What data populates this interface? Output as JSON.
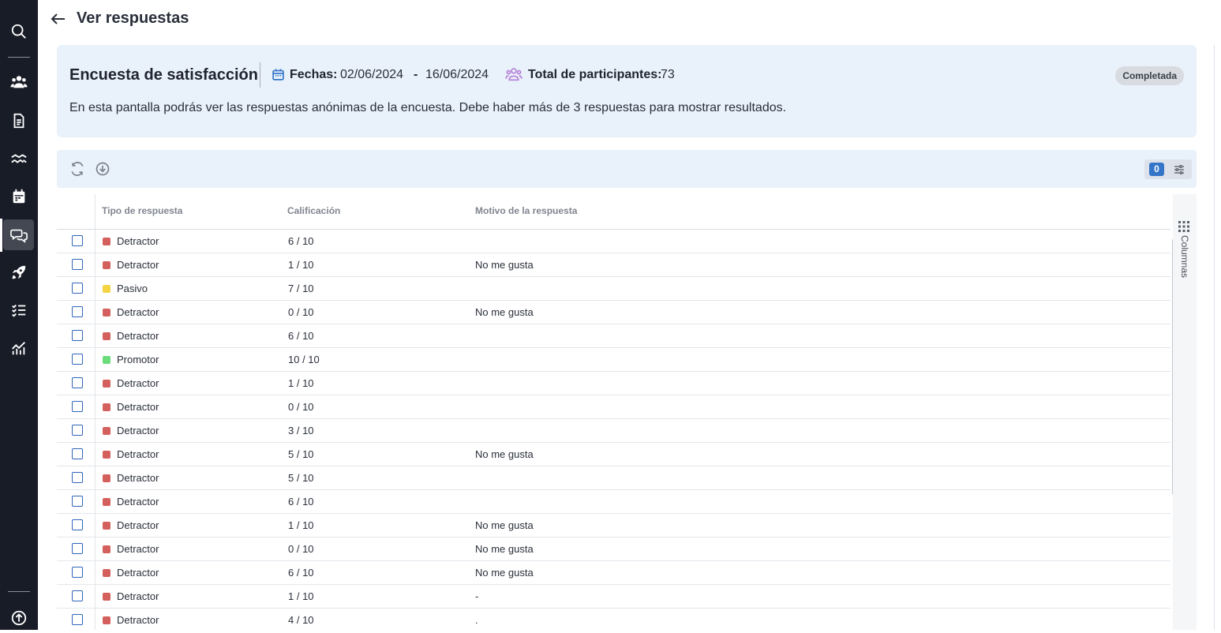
{
  "page": {
    "title": "Ver respuestas"
  },
  "survey": {
    "title": "Encuesta de satisfacción",
    "dates_label": "Fechas:",
    "date_from": "02/06/2024",
    "date_separator": "-",
    "date_to": "16/06/2024",
    "participants_label": "Total de participantes:",
    "participants_value": "73",
    "status": "Completada",
    "info": "En esta pantalla podrás ver las respuestas anónimas de la encuesta. Debe haber más de 3 respuestas para mostrar resultados."
  },
  "toolbar": {
    "filter_count": "0"
  },
  "table": {
    "columns": [
      "Tipo de respuesta",
      "Calificación",
      "Motivo de la respuesta"
    ],
    "side_panel_label": "Columnas",
    "type_colors": {
      "Detractor": "#d4605d",
      "Pasivo": "#f5d442",
      "Promotor": "#6bdc7b"
    },
    "rows": [
      {
        "type": "Detractor",
        "score": "6 / 10",
        "reason": ""
      },
      {
        "type": "Detractor",
        "score": "1 / 10",
        "reason": "No me gusta"
      },
      {
        "type": "Pasivo",
        "score": "7 / 10",
        "reason": ""
      },
      {
        "type": "Detractor",
        "score": "0 / 10",
        "reason": "No me gusta"
      },
      {
        "type": "Detractor",
        "score": "6 / 10",
        "reason": ""
      },
      {
        "type": "Promotor",
        "score": "10 / 10",
        "reason": ""
      },
      {
        "type": "Detractor",
        "score": "1 / 10",
        "reason": ""
      },
      {
        "type": "Detractor",
        "score": "0 / 10",
        "reason": ""
      },
      {
        "type": "Detractor",
        "score": "3 / 10",
        "reason": ""
      },
      {
        "type": "Detractor",
        "score": "5 / 10",
        "reason": "No me gusta"
      },
      {
        "type": "Detractor",
        "score": "5 / 10",
        "reason": ""
      },
      {
        "type": "Detractor",
        "score": "6 / 10",
        "reason": ""
      },
      {
        "type": "Detractor",
        "score": "1 / 10",
        "reason": "No me gusta"
      },
      {
        "type": "Detractor",
        "score": "0 / 10",
        "reason": "No me gusta"
      },
      {
        "type": "Detractor",
        "score": "6 / 10",
        "reason": "No me gusta"
      },
      {
        "type": "Detractor",
        "score": "1 / 10",
        "reason": "-"
      },
      {
        "type": "Detractor",
        "score": "4 / 10",
        "reason": "."
      }
    ]
  },
  "sidebar": {
    "icons": [
      "search-icon",
      "people-icon",
      "document-icon",
      "handshake-icon",
      "calendar-icon",
      "chat-icon",
      "rocket-icon",
      "checklist-icon",
      "analytics-icon",
      "upload-icon"
    ],
    "active": "chat-icon"
  }
}
